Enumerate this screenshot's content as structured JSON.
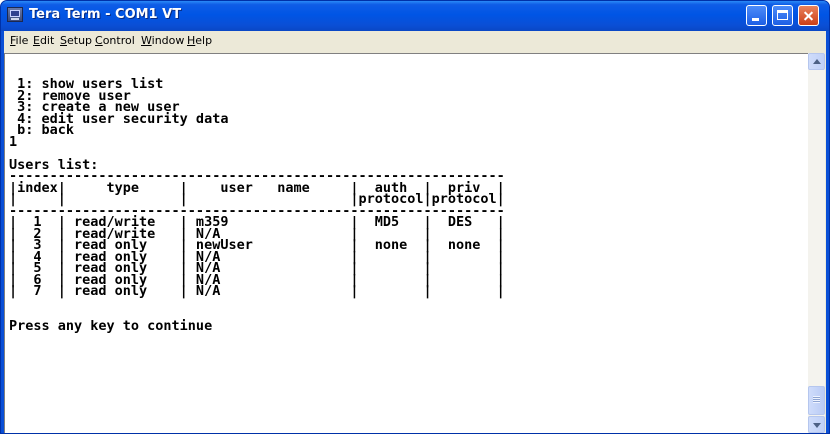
{
  "window": {
    "title": "Tera Term - COM1 VT"
  },
  "menubar": {
    "items": [
      "File",
      "Edit",
      "Setup",
      "Control",
      "Window",
      "Help"
    ]
  },
  "terminal": {
    "lines": [
      " 1: show users list",
      " 2: remove user",
      " 3: create a new user",
      " 4: edit user security data",
      " b: back",
      "1",
      "",
      "Users list:",
      "-------------------------------------------------------------",
      "|index|     type     |    user   name     |  auth  |  priv  |",
      "|     |              |                    |protocol|protocol|",
      "-------------------------------------------------------------",
      "|  1  | read/write   | m359               |  MD5   |  DES   |",
      "|  2  | read/write   | N/A                |        |        |",
      "|  3  | read only    | newUser            |  none  |  none  |",
      "|  4  | read only    | N/A                |        |        |",
      "|  5  | read only    | N/A                |        |        |",
      "|  6  | read only    | N/A                |        |        |",
      "|  7  | read only    | N/A                |        |        |",
      "",
      "",
      "Press any key to continue"
    ]
  }
}
